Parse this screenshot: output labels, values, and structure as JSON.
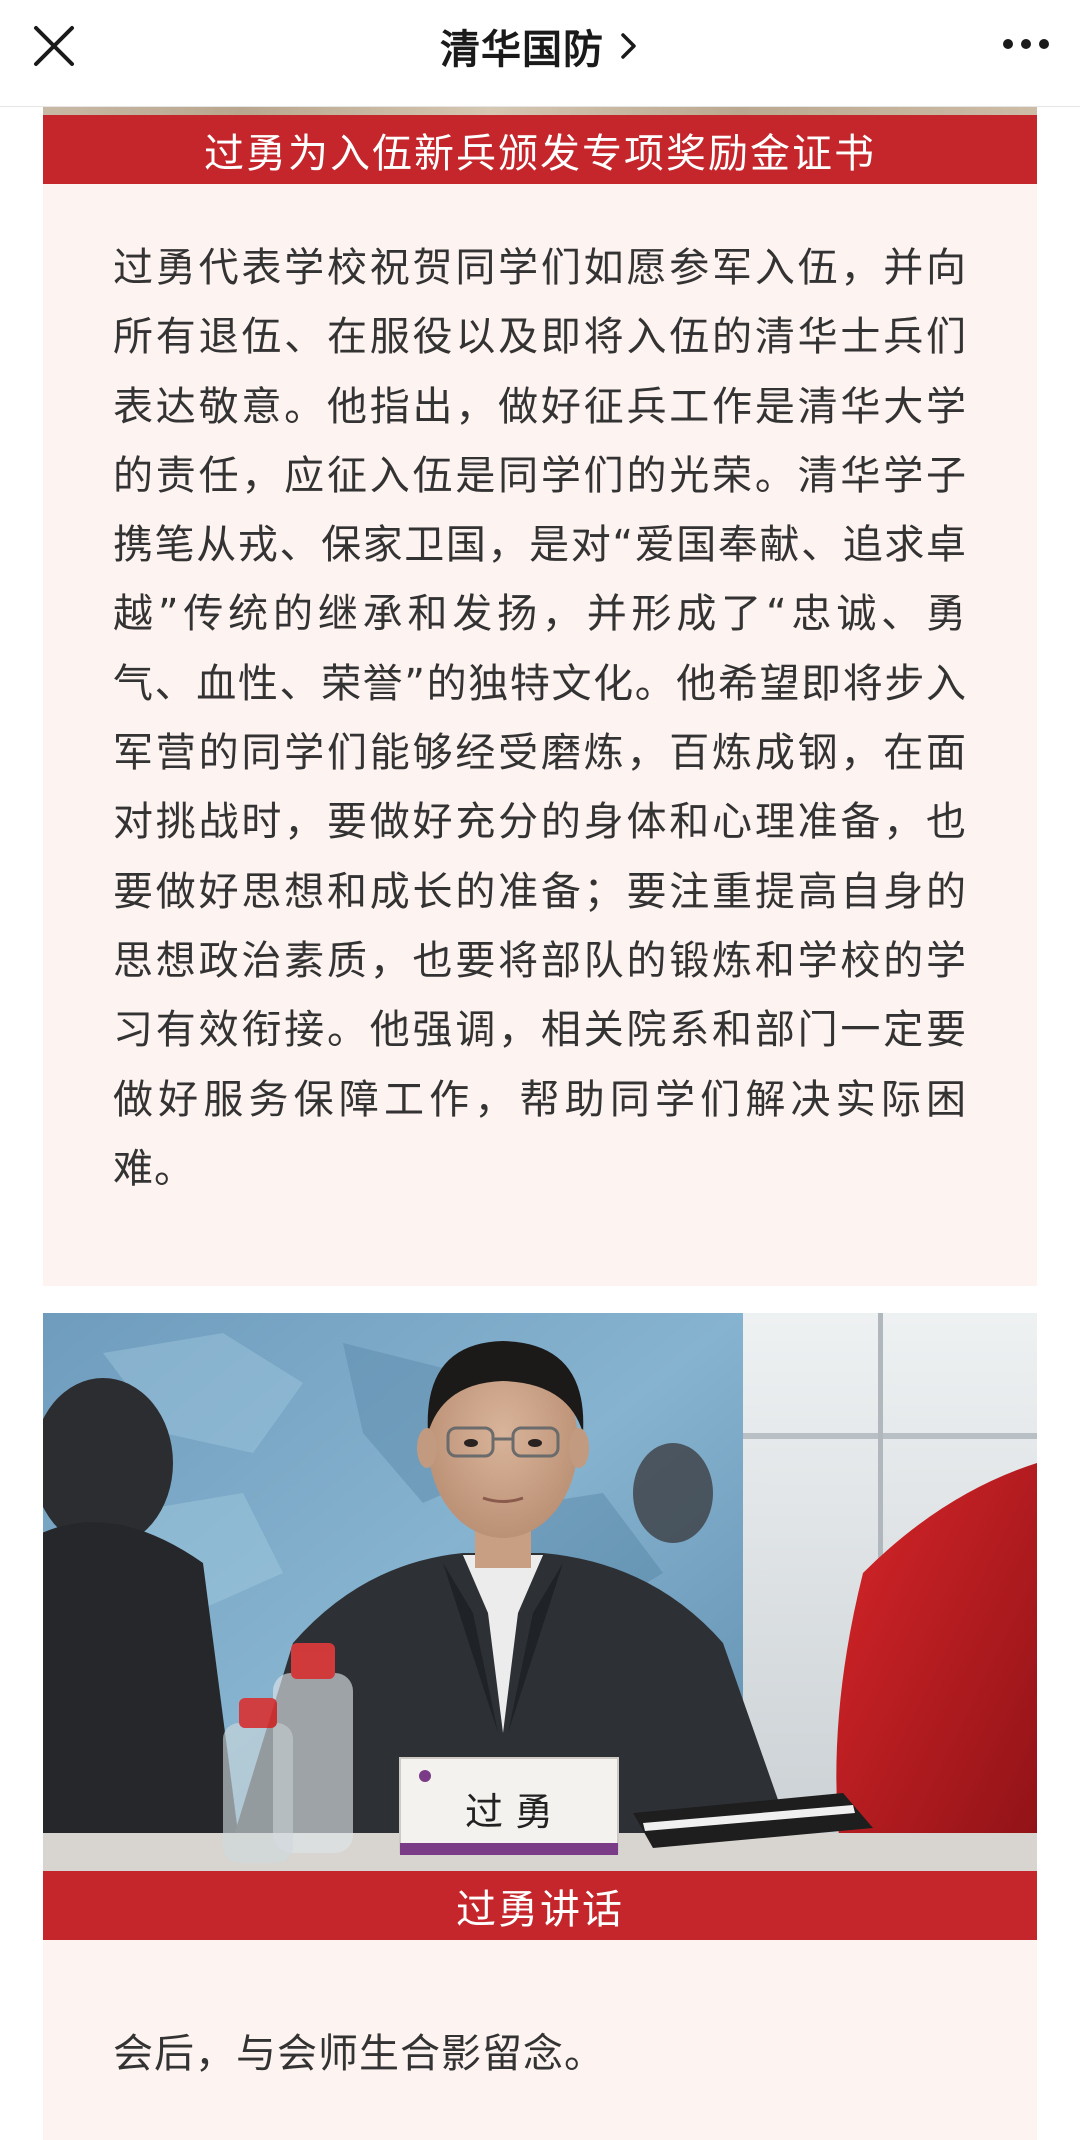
{
  "navbar": {
    "title": "清华国防",
    "close_icon": "close-icon",
    "chevron_icon": "chevron-right-icon",
    "more_icon": "more-dots-icon"
  },
  "article": {
    "section1_caption": "过勇为入伍新兵颁发专项奖励金证书",
    "section1_paragraph": "过勇代表学校祝贺同学们如愿参军入伍，并向所有退伍、在服役以及即将入伍的清华士兵们表达敬意。他指出，做好征兵工作是清华大学的责任，应征入伍是同学们的光荣。清华学子携笔从戎、保家卫国，是对“爱国奉献、追求卓越”传统的继承和发扬，并形成了“忠诚、勇气、血性、荣誉”的独特文化。他希望即将步入军营的同学们能够经受磨炼，百炼成钢，在面对挑战时，要做好充分的身体和心理准备，也要做好思想和成长的准备；要注重提高自身的思想政治素质，也要将部队的锻炼和学校的学习有效衔接。他强调，相关院系和部门一定要做好服务保障工作，帮助同学们解决实际困难。",
    "photo_nameplate": "过  勇",
    "photo_caption": "过勇讲话",
    "section2_paragraph": "会后，与会师生合影留念。"
  },
  "colors": {
    "banner_red": "#c4262b",
    "box_pink": "#fdf3f1",
    "text_dark": "#333333",
    "nav_text": "#1a1a1a"
  }
}
